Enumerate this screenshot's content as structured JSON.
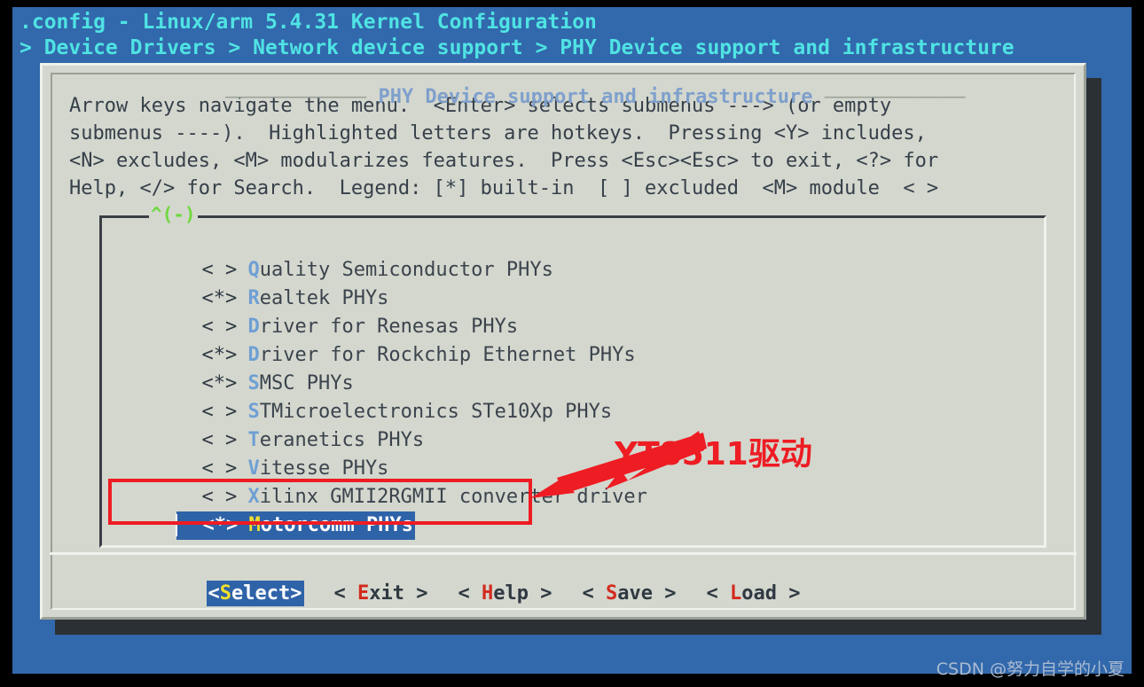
{
  "header": {
    "title": ".config - Linux/arm 5.4.31 Kernel Configuration",
    "breadcrumb": "> Device Drivers > Network device support > PHY Device support and infrastructure"
  },
  "dialog": {
    "caption": "PHY Device support and infrastructure",
    "rule_left": "———————————— ",
    "rule_right": " ————————————",
    "help_text": "Arrow keys navigate the menu.  <Enter> selects submenus ---> (or empty\nsubmenus ----).  Highlighted letters are hotkeys.  Pressing <Y> includes,\n<N> excludes, <M> modularizes features.  Press <Esc><Esc> to exit, <?> for\nHelp, </> for Search.  Legend: [*] built-in  [ ] excluded  <M> module  < >",
    "scroll_up_indicator": "^(-)"
  },
  "menu": {
    "items": [
      {
        "marker": "< >",
        "hotkey": "Q",
        "rest": "uality Semiconductor PHYs",
        "selected": false
      },
      {
        "marker": "<*>",
        "hotkey": "R",
        "rest": "ealtek PHYs",
        "selected": false
      },
      {
        "marker": "< >",
        "hotkey": "D",
        "rest": "river for Renesas PHYs",
        "selected": false
      },
      {
        "marker": "<*>",
        "hotkey": "D",
        "rest": "river for Rockchip Ethernet PHYs",
        "selected": false
      },
      {
        "marker": "<*>",
        "hotkey": "S",
        "rest": "MSC PHYs",
        "selected": false
      },
      {
        "marker": "< >",
        "hotkey": "S",
        "rest": "TMicroelectronics STe10Xp PHYs",
        "selected": false
      },
      {
        "marker": "< >",
        "hotkey": "T",
        "rest": "eranetics PHYs",
        "selected": false
      },
      {
        "marker": "< >",
        "hotkey": "V",
        "rest": "itesse PHYs",
        "selected": false
      },
      {
        "marker": "< >",
        "hotkey": "X",
        "rest": "ilinx GMII2RGMII converter driver",
        "selected": false
      },
      {
        "marker": "<*>",
        "hotkey": "M",
        "rest": "otorcomm PHYs",
        "selected": true
      }
    ]
  },
  "buttons": [
    {
      "pre": "<",
      "hotkey": "S",
      "post": "elect>",
      "active": true
    },
    {
      "pre": "< ",
      "hotkey": "E",
      "post": "xit >",
      "active": false
    },
    {
      "pre": "< ",
      "hotkey": "H",
      "post": "elp >",
      "active": false
    },
    {
      "pre": "< ",
      "hotkey": "S",
      "post": "ave >",
      "active": false
    },
    {
      "pre": "< ",
      "hotkey": "L",
      "post": "oad >",
      "active": false
    }
  ],
  "annotation": {
    "text": "YT8511驱动",
    "color": "#EE1C23"
  },
  "watermark": "CSDN @努力自学的小夏"
}
